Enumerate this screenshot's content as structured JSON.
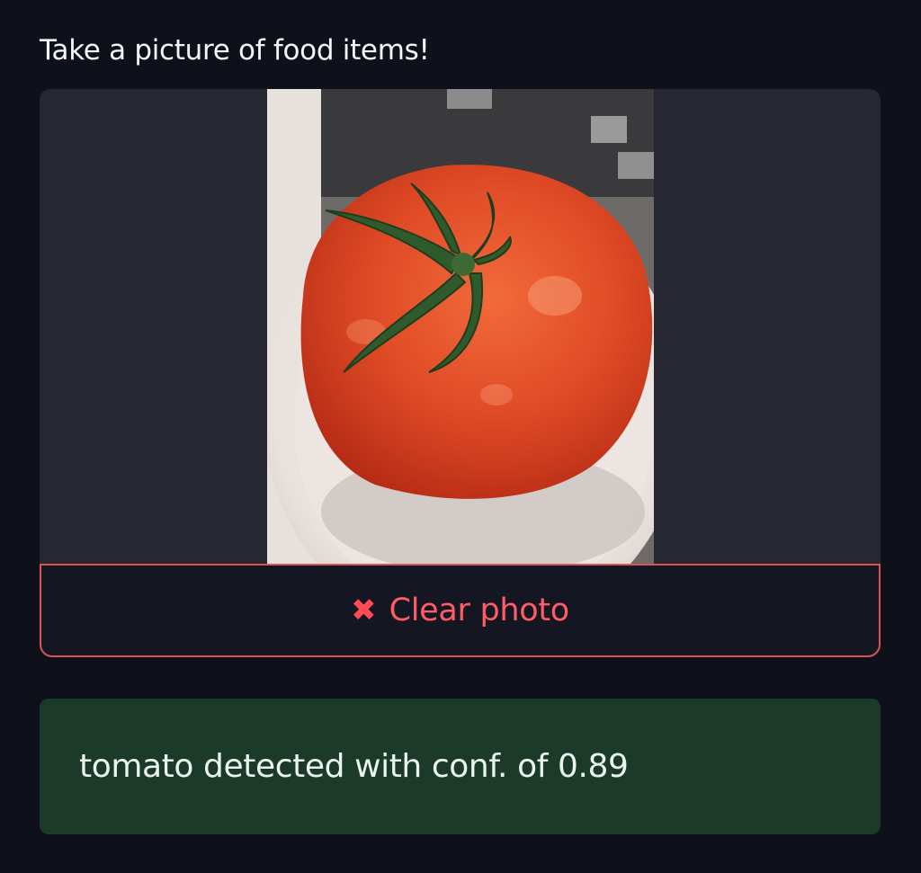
{
  "camera_input": {
    "label": "Take a picture of food items!",
    "photo_subject": "tomato-on-plate",
    "clear_button_label": "Clear photo",
    "clear_icon": "close-icon"
  },
  "result": {
    "message": "tomato detected with conf. of 0.89",
    "status": "success"
  },
  "colors": {
    "background": "#0f111a",
    "frame": "#262731",
    "accent": "#ff4b55",
    "success_bg": "#1b3a2a",
    "success_text": "#e8f4ec"
  }
}
